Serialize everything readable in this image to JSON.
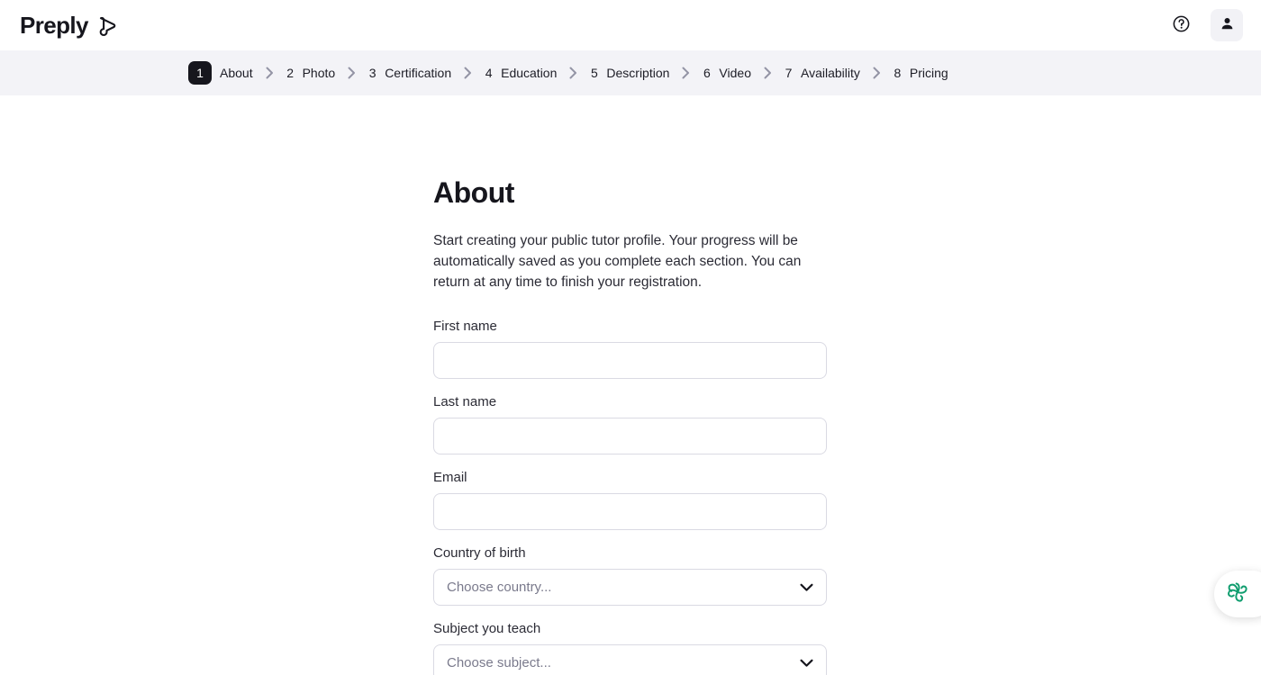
{
  "header": {
    "logo_text": "Preply",
    "logo_mark_icon": "preply-speech-bubble-icon",
    "help_icon": "question-mark-circle-icon",
    "avatar_icon": "user-person-icon"
  },
  "stepper": {
    "steps": [
      {
        "number": "1",
        "label": "About",
        "active": true
      },
      {
        "number": "2",
        "label": "Photo",
        "active": false
      },
      {
        "number": "3",
        "label": "Certification",
        "active": false
      },
      {
        "number": "4",
        "label": "Education",
        "active": false
      },
      {
        "number": "5",
        "label": "Description",
        "active": false
      },
      {
        "number": "6",
        "label": "Video",
        "active": false
      },
      {
        "number": "7",
        "label": "Availability",
        "active": false
      },
      {
        "number": "8",
        "label": "Pricing",
        "active": false
      }
    ],
    "separator_icon": "chevron-right-icon"
  },
  "main": {
    "title": "About",
    "description": "Start creating your public tutor profile. Your progress will be automatically saved as you complete each section. You can return at any time to finish your registration.",
    "fields": {
      "first_name": {
        "label": "First name",
        "value": "",
        "placeholder": ""
      },
      "last_name": {
        "label": "Last name",
        "value": "",
        "placeholder": ""
      },
      "email": {
        "label": "Email",
        "value": "",
        "placeholder": ""
      },
      "country": {
        "label": "Country of birth",
        "value": "Choose country...",
        "chevron_icon": "chevron-down-icon"
      },
      "subject": {
        "label": "Subject you teach",
        "value": "Choose subject...",
        "chevron_icon": "chevron-down-icon"
      }
    }
  },
  "chat_widget": {
    "icon": "pinwheel-chat-icon",
    "color": "#0f9d6e"
  },
  "colors": {
    "accent_dark": "#16161d",
    "stepper_bg": "#f3f3f7",
    "border": "#dadae3",
    "placeholder": "#7a7a8c",
    "chat_green": "#0f9d6e"
  }
}
